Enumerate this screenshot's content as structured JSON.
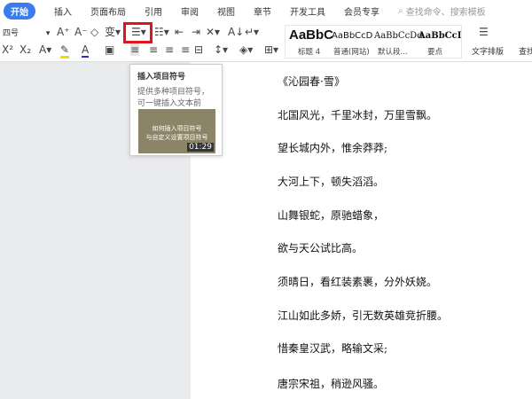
{
  "tabs": [
    "开始",
    "插入",
    "页面布局",
    "引用",
    "审阅",
    "视图",
    "章节",
    "开发工具",
    "会员专享"
  ],
  "search_placeholder": "查找命令、搜索模板",
  "font_size": "四号",
  "styles": [
    {
      "preview": "AaBbC",
      "label": "标题 4"
    },
    {
      "preview": "AaBbCcD",
      "label": "普通(网站)"
    },
    {
      "preview": "AaBbCcDd",
      "label": "默认段..."
    },
    {
      "preview": "AaBbCcDc",
      "label": "要点"
    }
  ],
  "text_layout": "文字排版",
  "find": "查找",
  "tooltip": {
    "title": "插入项目符号",
    "desc": "提供多种项目符号，可一键插入文本前",
    "video_title": "如何插入项目符号\n与自定义设置项目符号",
    "duration": "01:29"
  },
  "document": [
    "《沁园春·雪》",
    "北国风光，千里冰封，万里雪飘。",
    "望长城内外，惟余莽莽;",
    "大河上下，顿失滔滔。",
    "山舞银蛇，原驰蜡象，",
    "欲与天公试比高。",
    "须晴日，看红装素裹，分外妖娆。",
    "江山如此多娇，引无数英雄竞折腰。",
    "惜秦皇汉武，略输文采;",
    "唐宗宋祖，稍逊风骚。"
  ]
}
